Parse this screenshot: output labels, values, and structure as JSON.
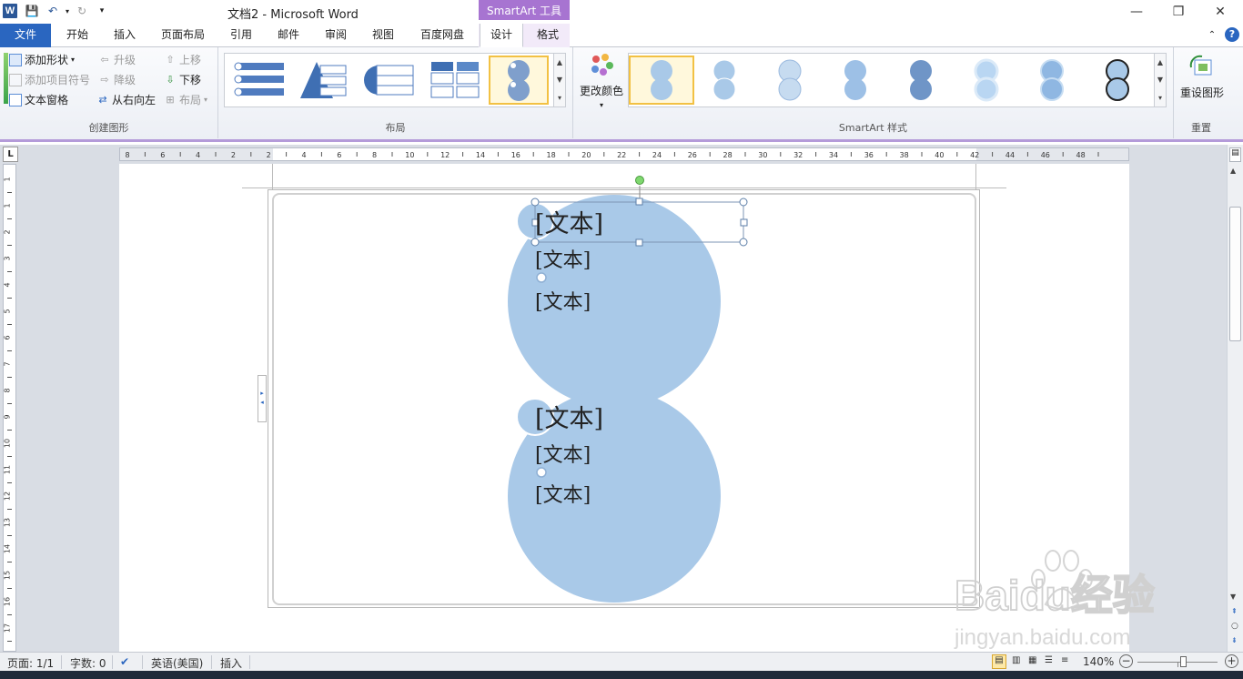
{
  "window": {
    "title": "文档2 - Microsoft Word",
    "context_tools": "SmartArt 工具",
    "app_icon": "W"
  },
  "tabs": [
    "文件",
    "开始",
    "插入",
    "页面布局",
    "引用",
    "邮件",
    "审阅",
    "视图",
    "百度网盘",
    "设计",
    "格式"
  ],
  "ribbon": {
    "create_graphic": {
      "label": "创建图形",
      "add_shape": "添加形状",
      "add_bullet": "添加项目符号",
      "text_pane": "文本窗格",
      "promote": "升级",
      "demote": "降级",
      "right_to_left": "从右向左",
      "move_up": "上移",
      "move_down": "下移",
      "layout": "布局"
    },
    "layouts": {
      "label": "布局"
    },
    "change_colors": "更改颜色",
    "styles": {
      "label": "SmartArt 样式"
    },
    "reset": {
      "label": "重置",
      "reset_graphic": "重设图形"
    }
  },
  "document": {
    "shapes": [
      {
        "title": "[文本]",
        "items": [
          "[文本]",
          "[文本]"
        ]
      },
      {
        "title": "[文本]",
        "items": [
          "[文本]",
          "[文本]"
        ]
      }
    ]
  },
  "statusbar": {
    "page": "页面: 1/1",
    "words": "字数: 0",
    "language": "英语(美国)",
    "mode": "插入",
    "zoom": "140%"
  },
  "watermark": {
    "brand": "Baidu经验",
    "url": "jingyan.baidu.com"
  },
  "colors": {
    "accent_purple": "#a774d1",
    "file_tab": "#2a66c0",
    "circle": "#a9c9e8"
  },
  "ruler_labels": {
    "h": [
      "8",
      "6",
      "4",
      "2",
      "2",
      "4",
      "6",
      "8",
      "10",
      "12",
      "14",
      "16",
      "18",
      "20",
      "22",
      "24",
      "26",
      "28",
      "30",
      "32",
      "34",
      "36",
      "38",
      "40",
      "42",
      "44",
      "46",
      "48"
    ],
    "v": [
      "1",
      "1",
      "2",
      "3",
      "4",
      "5",
      "6",
      "7",
      "8",
      "9",
      "10",
      "11",
      "12",
      "13",
      "14",
      "15",
      "16",
      "17"
    ]
  }
}
